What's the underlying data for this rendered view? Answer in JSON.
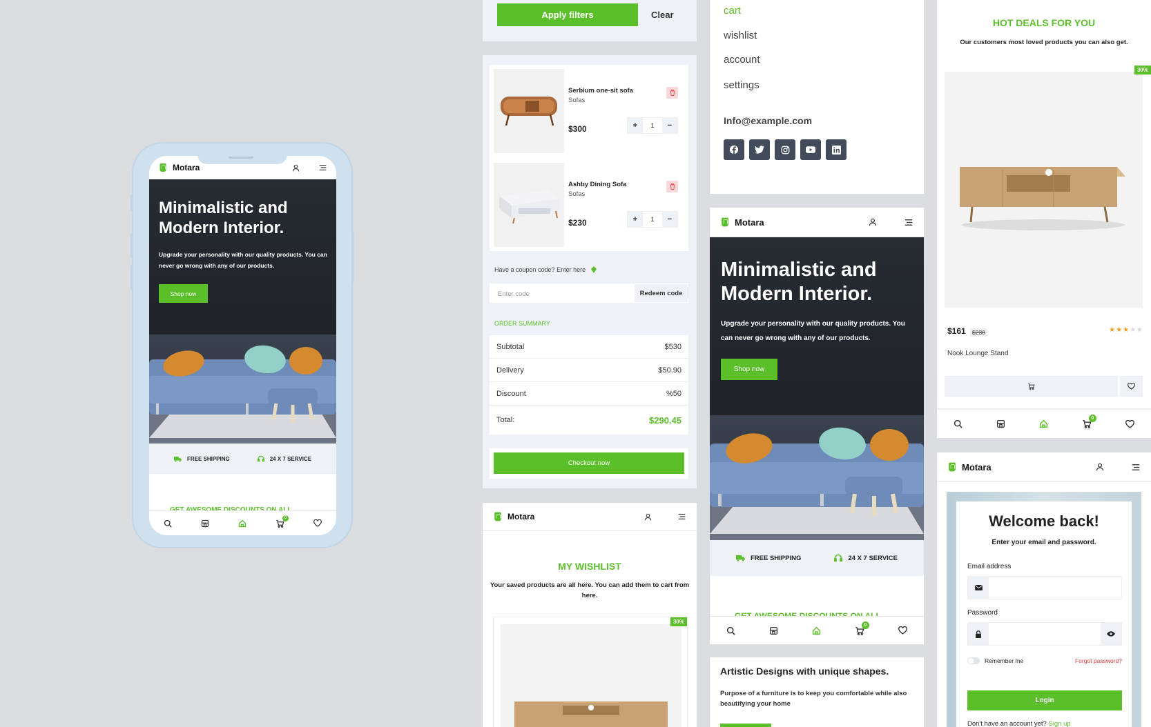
{
  "brand": {
    "name": "Motara"
  },
  "colors": {
    "accent": "#5bbf2a",
    "dark": "#1f2228",
    "background": "#dcdde0"
  },
  "hero": {
    "title_line1": "Minimalistic and",
    "title_line2": "Modern Interior.",
    "subtitle": "Upgrade your personality with our quality products. You can never go wrong with any of our products.",
    "cta": "Shop now"
  },
  "features": {
    "shipping": "FREE SHIPPING",
    "service": "24 X 7 SERVICE"
  },
  "discounts_heading": "GET AWESOME DISCOUNTS ON ALL",
  "nav": {
    "cart_count": "0",
    "icons": [
      "search-icon",
      "store-icon",
      "home-icon",
      "cart-icon",
      "heart-icon"
    ]
  },
  "filters": {
    "apply": "Apply filters",
    "clear": "Clear"
  },
  "cart": {
    "items": [
      {
        "name": "Serbium one-sit sofa",
        "category": "Sofas",
        "price": "$300",
        "qty": "1"
      },
      {
        "name": "Ashby Dining Sofa",
        "category": "Sofas",
        "price": "$230",
        "qty": "1"
      }
    ],
    "coupon_prompt": "Have a coupon code? Enter here",
    "coupon_placeholder": "Enter code",
    "redeem": "Redeem code",
    "summary_title": "ORDER SUMMARY",
    "summary": [
      {
        "label": "Subtotal",
        "value": "$530"
      },
      {
        "label": "Delivery",
        "value": "$50.90"
      },
      {
        "label": "Discount",
        "value": "%50"
      }
    ],
    "total_label": "Total:",
    "total_value": "$290.45",
    "checkout": "Checkout now"
  },
  "menu": {
    "links": [
      "cart",
      "wishlist",
      "account",
      "settings"
    ],
    "email": "Info@example.com",
    "social": [
      "facebook-icon",
      "twitter-icon",
      "instagram-icon",
      "youtube-icon",
      "linkedin-icon"
    ]
  },
  "wishlist": {
    "title": "MY WISHLIST",
    "subtitle": "Your saved products are all here. You can add them to cart from here.",
    "badge": "30%"
  },
  "hot_deals": {
    "title": "HOT DEALS FOR YOU",
    "subtitle": "Our customers most loved products you can also get.",
    "badge": "30%",
    "price": "$161",
    "old_price": "$230",
    "rating": 3,
    "rating_max": 5,
    "product": "Nook Lounge Stand"
  },
  "artistic": {
    "title": "Artistic Designs with unique shapes.",
    "text": "Purpose of a furniture is to keep you comfortable while also beautifying your home"
  },
  "login": {
    "title": "Welcome back!",
    "subtitle": "Enter your email and password.",
    "email_label": "Email address",
    "password_label": "Password",
    "remember": "Remember me",
    "forgot": "Forgot password?",
    "button": "Login",
    "no_account": "Don't have an account yet?",
    "signup": "Sign up"
  }
}
